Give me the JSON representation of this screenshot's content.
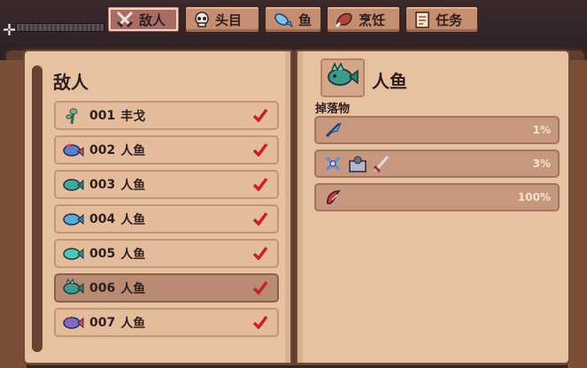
{
  "tabs": [
    {
      "label": "敌人",
      "icon": "crossed-swords-icon",
      "active": true
    },
    {
      "label": "头目",
      "icon": "skull-icon",
      "active": false
    },
    {
      "label": "鱼",
      "icon": "fish-icon",
      "active": false
    },
    {
      "label": "烹饪",
      "icon": "meat-icon",
      "active": false
    },
    {
      "label": "任务",
      "icon": "quest-scroll-icon",
      "active": false
    }
  ],
  "left_page": {
    "title": "敌人",
    "entries": [
      {
        "number": "001",
        "name": "丰戈",
        "icon": "green-sprout-icon",
        "completed": true
      },
      {
        "number": "002",
        "name": "人鱼",
        "icon": "red-blue-fish-icon",
        "completed": true
      },
      {
        "number": "003",
        "name": "人鱼",
        "icon": "teal-fish-icon",
        "completed": true
      },
      {
        "number": "004",
        "name": "人鱼",
        "icon": "blue-fish-icon",
        "completed": true
      },
      {
        "number": "005",
        "name": "人鱼",
        "icon": "cyan-fish-icon",
        "completed": true
      },
      {
        "number": "006",
        "name": "人鱼",
        "icon": "spiky-teal-fish-icon",
        "completed": true,
        "selected": true
      },
      {
        "number": "007",
        "name": "人鱼",
        "icon": "purple-fish-icon",
        "completed": true
      }
    ]
  },
  "right_page": {
    "name": "人鱼",
    "portrait_icon": "spiky-teal-fish-icon",
    "drops_label": "掉落物",
    "drops": [
      {
        "percent": "1%",
        "items": [
          "blue-feather-icon"
        ]
      },
      {
        "percent": "3%",
        "items": [
          "ribbon-icon",
          "gear-box-icon",
          "sword-icon"
        ]
      },
      {
        "percent": "100%",
        "items": [
          "red-claw-icon"
        ]
      }
    ]
  },
  "colors": {
    "check": "#c8202a",
    "page": "#e7c2a0",
    "row": "#e4bc9b",
    "selected_row": "#b98b73",
    "drop_row": "#c8987e"
  }
}
